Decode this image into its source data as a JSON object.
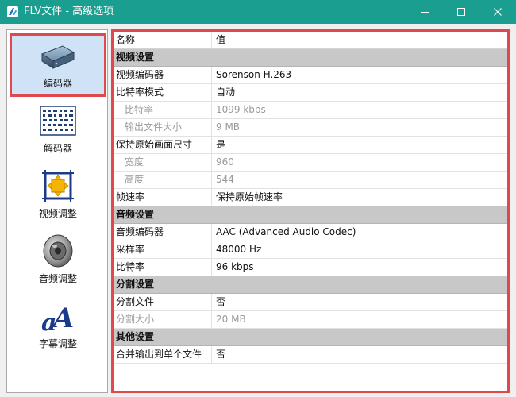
{
  "window": {
    "title": "FLV文件 - 高级选项"
  },
  "sidebar": {
    "items": [
      {
        "label": "编码器",
        "icon": "encoder-box-icon",
        "selected": true
      },
      {
        "label": "解码器",
        "icon": "decoder-grid-icon",
        "selected": false
      },
      {
        "label": "视频调整",
        "icon": "video-adjust-frame-icon",
        "selected": false
      },
      {
        "label": "音频调整",
        "icon": "speaker-icon",
        "selected": false
      },
      {
        "label": "字幕调整",
        "icon": "subtitle-letter-icon",
        "selected": false
      }
    ]
  },
  "grid": {
    "header": {
      "name": "名称",
      "value": "值"
    },
    "rows": [
      {
        "type": "category",
        "label": "视频设置"
      },
      {
        "type": "prop",
        "name": "视频编码器",
        "value": "Sorenson H.263"
      },
      {
        "type": "prop",
        "name": "比特率模式",
        "value": "自动"
      },
      {
        "type": "prop",
        "name": "比特率",
        "value": "1099 kbps",
        "indent": true,
        "disabled": true
      },
      {
        "type": "prop",
        "name": "输出文件大小",
        "value": "9 MB",
        "indent": true,
        "disabled": true
      },
      {
        "type": "prop",
        "name": "保持原始画面尺寸",
        "value": "是"
      },
      {
        "type": "prop",
        "name": "宽度",
        "value": "960",
        "indent": true,
        "disabled": true
      },
      {
        "type": "prop",
        "name": "高度",
        "value": "544",
        "indent": true,
        "disabled": true
      },
      {
        "type": "prop",
        "name": "帧速率",
        "value": "保持原始帧速率"
      },
      {
        "type": "category",
        "label": "音频设置"
      },
      {
        "type": "prop",
        "name": "音频编码器",
        "value": "AAC (Advanced Audio Codec)"
      },
      {
        "type": "prop",
        "name": "采样率",
        "value": "48000 Hz"
      },
      {
        "type": "prop",
        "name": "比特率",
        "value": "96 kbps"
      },
      {
        "type": "category",
        "label": "分割设置"
      },
      {
        "type": "prop",
        "name": "分割文件",
        "value": "否"
      },
      {
        "type": "prop",
        "name": "分割大小",
        "value": "20 MB",
        "disabled": true
      },
      {
        "type": "category",
        "label": "其他设置"
      },
      {
        "type": "prop",
        "name": "合并输出到单个文件",
        "value": "否"
      }
    ]
  },
  "colors": {
    "titlebar": "#1a9e8f",
    "highlight_border": "#e0484e",
    "category_bg": "#c8c8c8",
    "disabled_text": "#9a9a9a"
  }
}
